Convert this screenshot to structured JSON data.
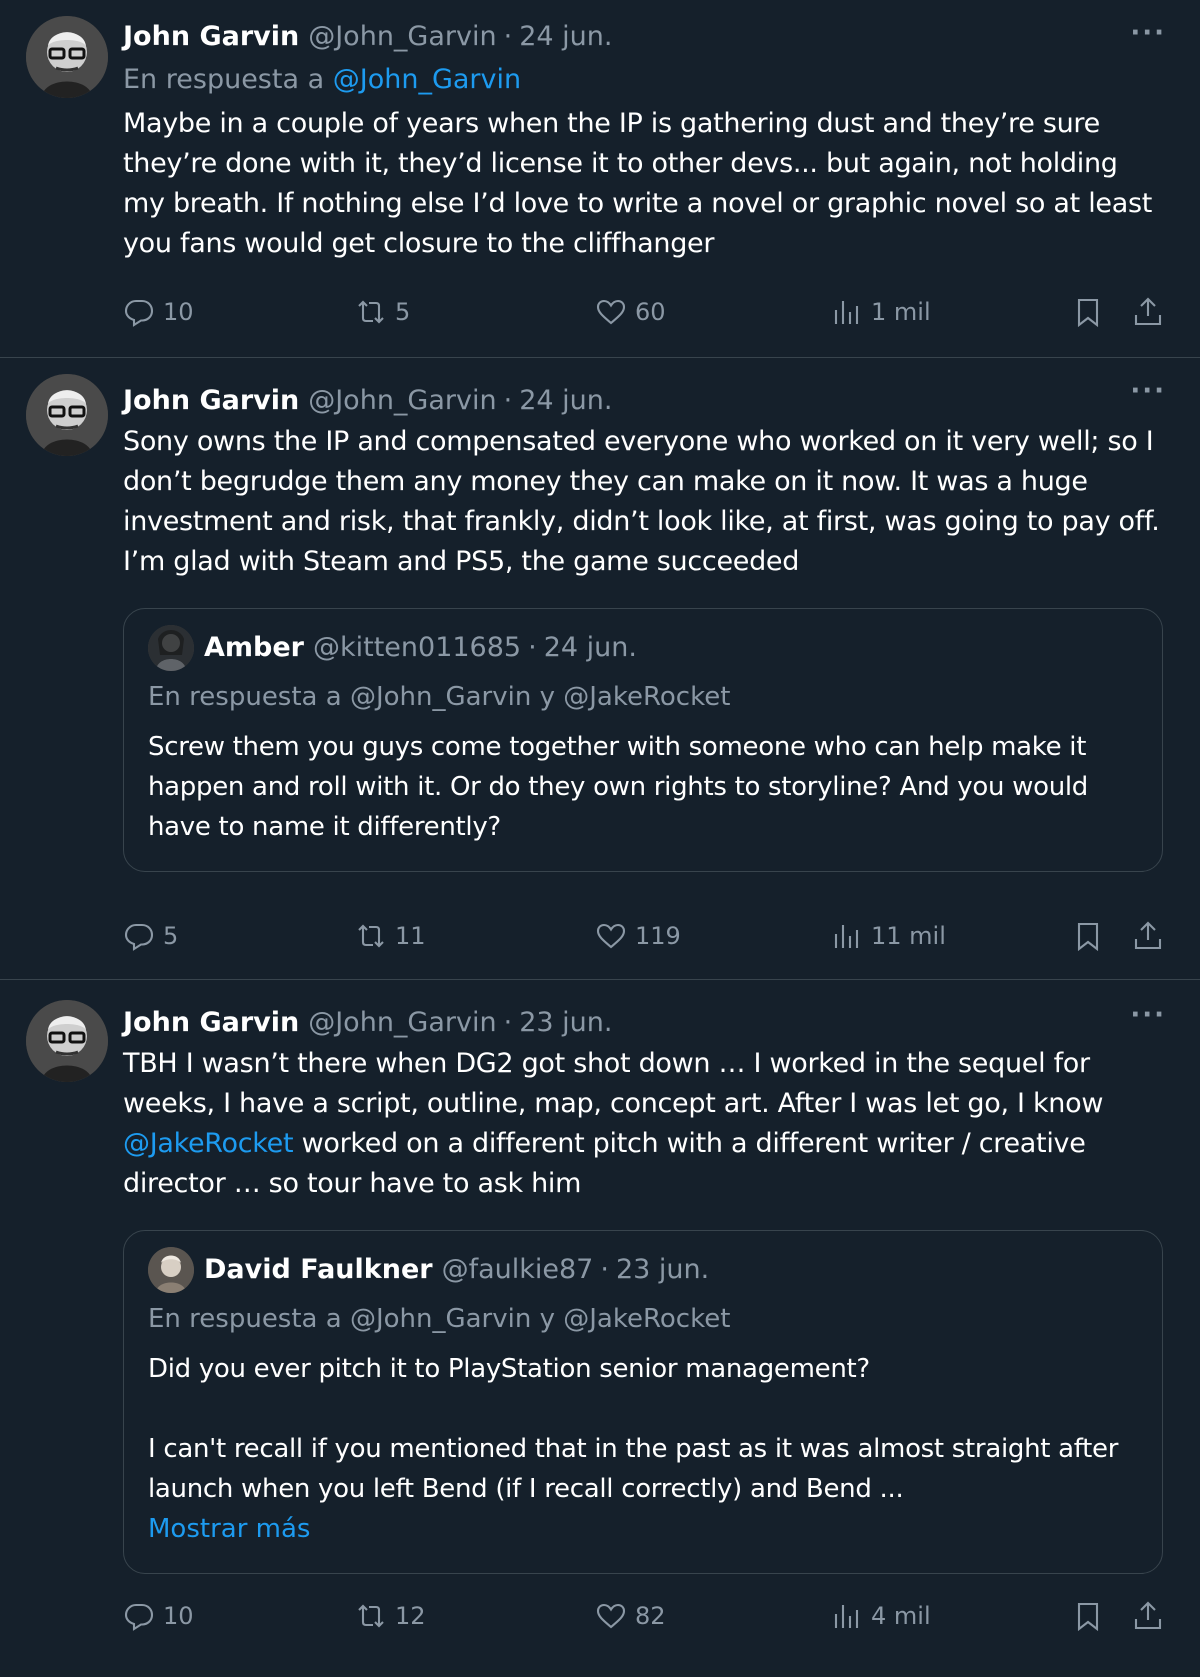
{
  "tweets": [
    {
      "author": "John Garvin",
      "handle": "@John_Garvin",
      "dot": "·",
      "date": "24 jun.",
      "reply_prefix": "En respuesta a",
      "reply_to": "@John_Garvin",
      "text": "Maybe in a couple of years when the IP is gathering dust and they’re sure they’re done with it, they’d license it to other devs... but again, not holding my breath. If nothing else I’d love to write a novel or graphic novel so at least you fans would get closure to the cliffhanger",
      "stats": {
        "replies": "10",
        "retweets": "5",
        "likes": "60",
        "views": "1 mil"
      }
    },
    {
      "author": "John Garvin",
      "handle": "@John_Garvin",
      "dot": "·",
      "date": "24 jun.",
      "text": "Sony owns the IP and compensated everyone who worked on it very well; so I don’t begrudge them any money they can make on it now. It was a huge investment and risk, that frankly, didn’t look like, at first, was going to pay off. I’m glad with Steam and PS5, the game succeeded",
      "quote": {
        "author": "Amber",
        "handle": "@kitten011685",
        "dot": "·",
        "date": "24 jun.",
        "reply_line": "En respuesta a @John_Garvin y @JakeRocket",
        "text": "Screw them you guys come together with someone who can help make it happen and roll with it. Or do they own rights to storyline? And you would have to name it differently?"
      },
      "stats": {
        "replies": "5",
        "retweets": "11",
        "likes": "119",
        "views": "11 mil"
      }
    },
    {
      "author": "John Garvin",
      "handle": "@John_Garvin",
      "dot": "·",
      "date": "23 jun.",
      "text_before": "TBH I wasn’t there when DG2 got shot down … I worked in the sequel for weeks, I have a script, outline, map, concept art. After I was let go, I know ",
      "mention": "@JakeRocket",
      "text_after": " worked on a different pitch with a different writer / creative director … so tour have to ask him",
      "quote": {
        "author": "David Faulkner",
        "handle": "@faulkie87",
        "dot": "·",
        "date": "23 jun.",
        "reply_line": "En respuesta a @John_Garvin y @JakeRocket",
        "text_p1": "Did you ever pitch it to PlayStation senior management?",
        "text_p2": "I can't recall if you mentioned that in the past as it was almost straight after launch when you left Bend (if I recall correctly) and Bend ...",
        "show_more": "Mostrar más"
      },
      "stats": {
        "replies": "10",
        "retweets": "12",
        "likes": "82",
        "views": "4 mil"
      }
    }
  ],
  "icons": {
    "more": "···",
    "reply": "reply-icon",
    "retweet": "retweet-icon",
    "like": "heart-icon",
    "views": "views-icon",
    "bookmark": "bookmark-icon",
    "share": "share-icon"
  },
  "colors": {
    "background": "#15202b",
    "text": "#ffffff",
    "secondary": "#8b98a5",
    "link": "#1d9bf0",
    "border": "#38444d"
  }
}
